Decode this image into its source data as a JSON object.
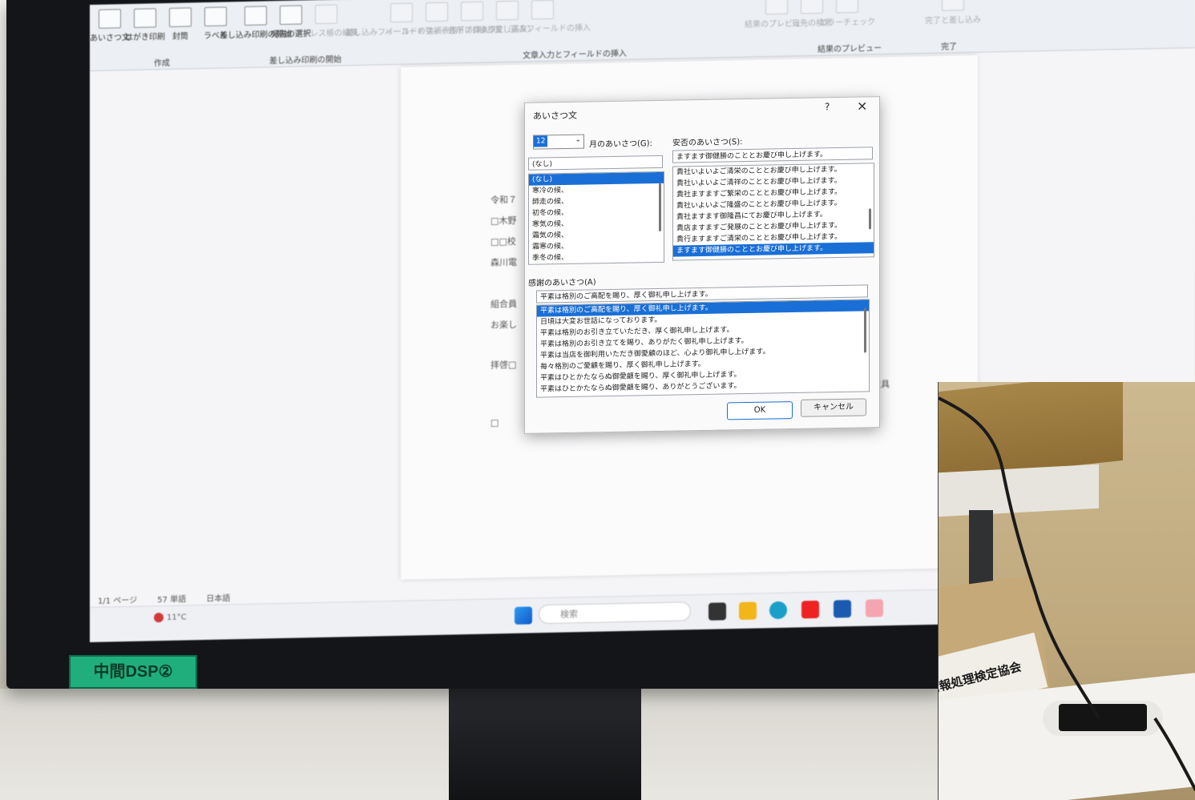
{
  "ribbon": {
    "groups": [
      {
        "title": "作成",
        "tools": [
          "あいさつ文",
          "はがき印刷",
          "封筒",
          "ラベル"
        ]
      },
      {
        "title": "差し込み印刷の開始",
        "tools": [
          "差し込み印刷の開始",
          "宛先の選択",
          "アドレス帳の編集"
        ]
      },
      {
        "title": "文章入力とフィールドの挿入",
        "tools": [
          "差し込みフィールドの強調表示",
          "バーコードフィールドの挿入",
          "住所ブロック",
          "挨拶文（英文）",
          "差し込みフィールドの挿入",
          "フィールドの対応",
          "複数ラベルに反映"
        ]
      },
      {
        "title": "結果のプレビュー",
        "tools": [
          "結果のプレビュー",
          "宛先の検索",
          "エラーチェック"
        ]
      },
      {
        "title": "完了",
        "tools": [
          "完了と差し込み"
        ]
      }
    ]
  },
  "document": {
    "lines": [
      "令和７",
      "□木野",
      "□□校",
      "森川電",
      "組合員",
      "お楽し",
      "拝啓□",
      "□"
    ],
    "right_text": "敬具"
  },
  "statusbar": {
    "page": "1/1 ページ",
    "words": "57 単語",
    "lang": "日本語"
  },
  "taskbar": {
    "search": "検索",
    "temp": "11°C"
  },
  "dialog": {
    "title": "あいさつ文",
    "help": "?",
    "close": "×",
    "month_value": "12",
    "month_label": "月のあいさつ(G):",
    "month_first": "(なし)",
    "month_items": [
      "(なし)",
      "寒冷の候、",
      "師走の候、",
      "初冬の候、",
      "寒気の候、",
      "霜気の候、",
      "霜寒の候、",
      "季冬の候、"
    ],
    "safety_label": "安否のあいさつ(S):",
    "safety_value": "ますます御健勝のこととお慶び申し上げます。",
    "safety_items": [
      "貴社いよいよご清栄のこととお慶び申し上げます。",
      "貴社いよいよご清祥のこととお慶び申し上げます。",
      "貴社ますますご繁栄のこととお慶び申し上げます。",
      "貴社いよいよご隆盛のこととお慶び申し上げます。",
      "貴社ますます御隆昌にてお慶び申し上げます。",
      "貴店ますますご発展のこととお慶び申し上げます。",
      "貴行ますますご清栄のこととお慶び申し上げます。",
      "ますます御健勝のこととお慶び申し上げます。"
    ],
    "thanks_label": "感謝のあいさつ(A)",
    "thanks_value": "平素は格別のご高配を賜り、厚く御礼申し上げます。",
    "thanks_items": [
      "平素は格別のご高配を賜り、厚く御礼申し上げます。",
      "日頃は大変お世話になっております。",
      "平素は格別のお引き立ていただき、厚く御礼申し上げます。",
      "平素は格別のお引き立てを賜り、ありがたく御礼申し上げます。",
      "平素は当店を御利用いただき御愛顧のほど、心より御礼申し上げます。",
      "毎々格別のご愛顧を賜り、厚く御礼申し上げます。",
      "平素はひとかたならぬ御愛顧を賜り、厚く御礼申し上げます。",
      "平素はひとかたならぬ御愛顧を賜り、ありがとうございます。"
    ],
    "ok": "OK",
    "cancel": "キャンセル"
  },
  "monitor_label": "中間DSP②",
  "inset": {
    "sign_text": "情報処理検定協会"
  }
}
